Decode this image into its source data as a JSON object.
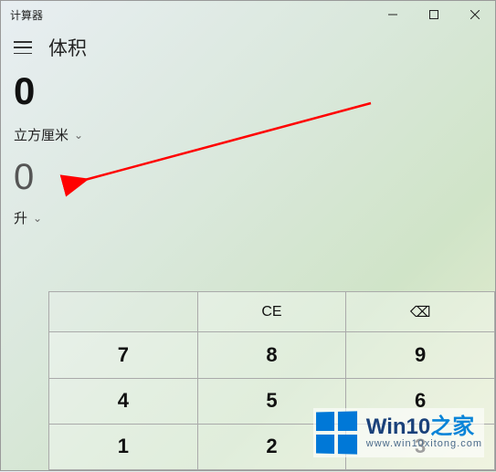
{
  "window": {
    "title": "计算器"
  },
  "header": {
    "mode": "体积"
  },
  "input": {
    "value": "0",
    "unit": "立方厘米"
  },
  "output": {
    "value": "0",
    "unit": "升"
  },
  "keypad": {
    "ce": "CE",
    "backspace": "⌫",
    "k7": "7",
    "k8": "8",
    "k9": "9",
    "k4": "4",
    "k5": "5",
    "k6": "6",
    "k1": "1",
    "k2": "2",
    "k3": "3"
  },
  "watermark": {
    "brand_prefix": "Win10",
    "brand_suffix": "之家",
    "url": "www.win10xitong.com"
  }
}
